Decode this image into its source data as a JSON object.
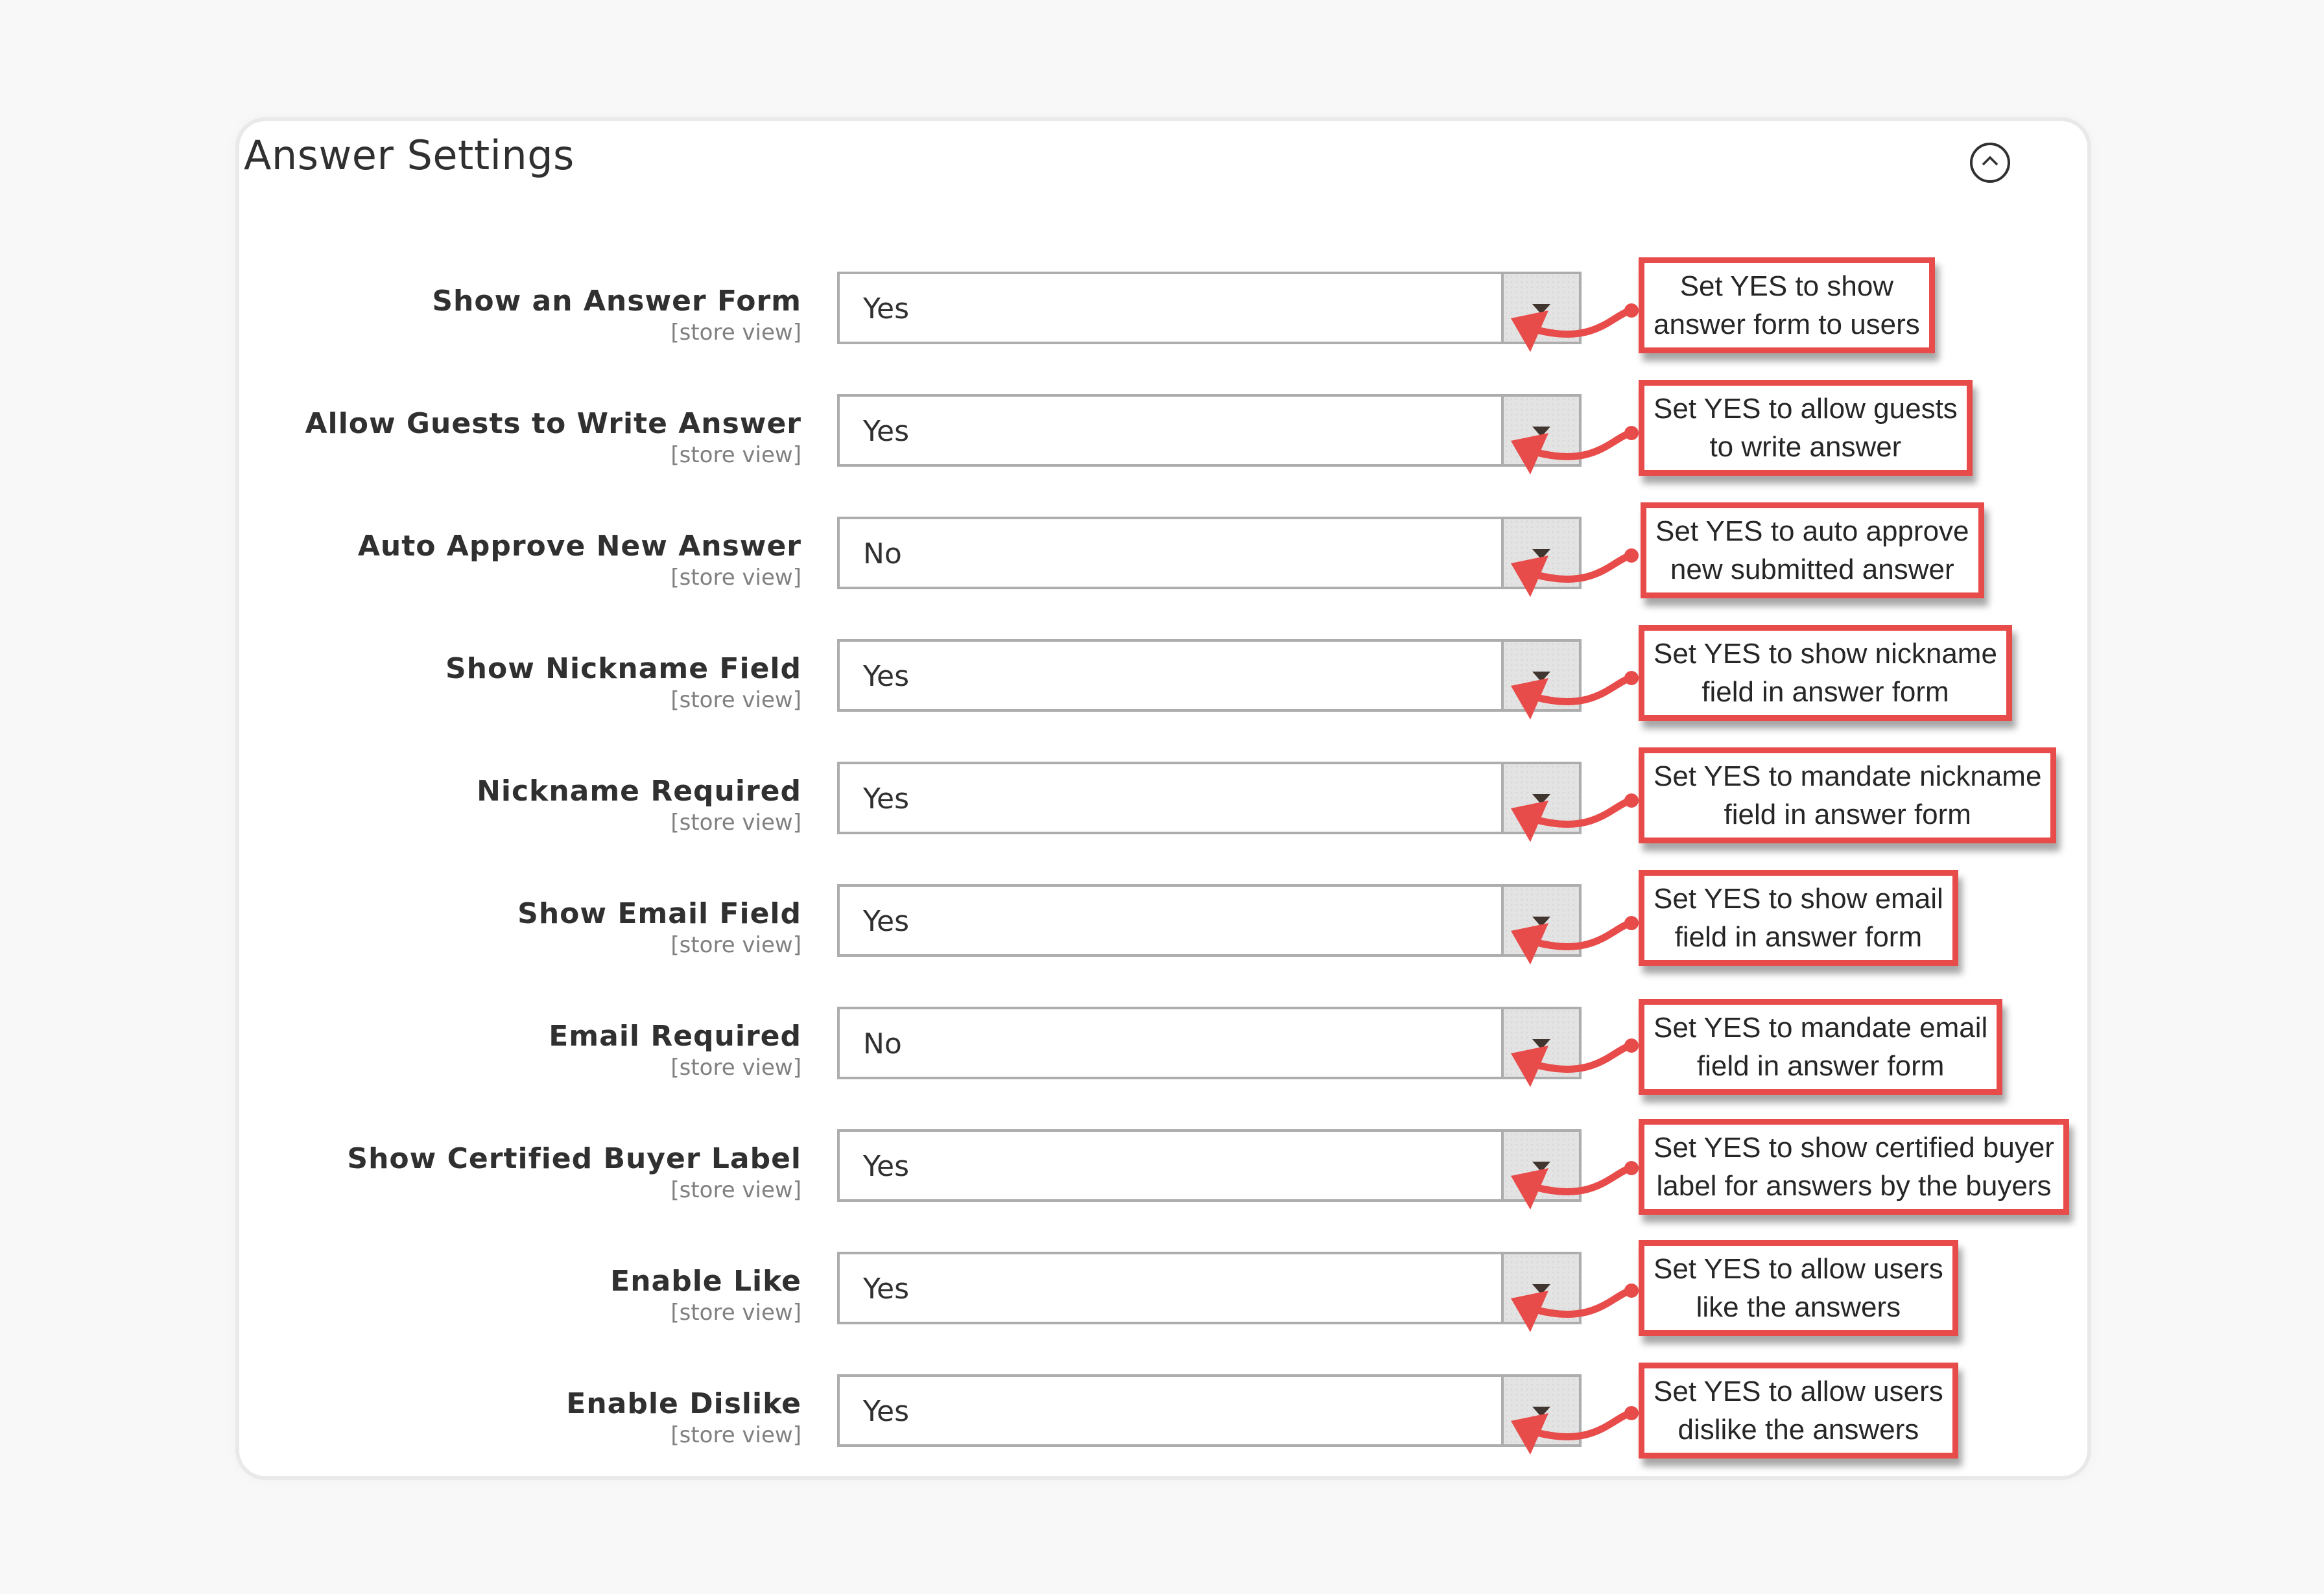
{
  "section": {
    "title": "Answer Settings",
    "collapse_icon": "chevron-up-circle-icon"
  },
  "annotation_color": "#e84c4a",
  "fields": [
    {
      "label": "Show an Answer Form",
      "scope": "[store view]",
      "value": "Yes",
      "callout": [
        "Set YES to show",
        "answer form to users"
      ]
    },
    {
      "label": "Allow Guests to Write Answer",
      "scope": "[store view]",
      "value": "Yes",
      "callout": [
        "Set YES to allow guests",
        "to write answer"
      ]
    },
    {
      "label": "Auto Approve New Answer",
      "scope": "[store view]",
      "value": "No",
      "callout": [
        "Set YES to auto approve",
        "new submitted answer"
      ]
    },
    {
      "label": "Show Nickname Field",
      "scope": "[store view]",
      "value": "Yes",
      "callout": [
        "Set YES to show nickname",
        "field in answer form"
      ]
    },
    {
      "label": "Nickname Required",
      "scope": "[store view]",
      "value": "Yes",
      "callout": [
        "Set YES to mandate nickname",
        "field in answer form"
      ]
    },
    {
      "label": "Show Email Field",
      "scope": "[store view]",
      "value": "Yes",
      "callout": [
        "Set YES to show email",
        "field in answer form"
      ]
    },
    {
      "label": "Email Required",
      "scope": "[store view]",
      "value": "No",
      "callout": [
        "Set YES to mandate email",
        "field in answer form"
      ]
    },
    {
      "label": "Show Certified Buyer Label",
      "scope": "[store view]",
      "value": "Yes",
      "callout": [
        "Set YES to show certified buyer",
        "label for answers by the buyers"
      ]
    },
    {
      "label": "Enable Like",
      "scope": "[store view]",
      "value": "Yes",
      "callout": [
        "Set YES to allow users",
        "like the answers"
      ]
    },
    {
      "label": "Enable Dislike",
      "scope": "[store view]",
      "value": "Yes",
      "callout": [
        "Set YES to allow users",
        "dislike the answers"
      ]
    }
  ]
}
